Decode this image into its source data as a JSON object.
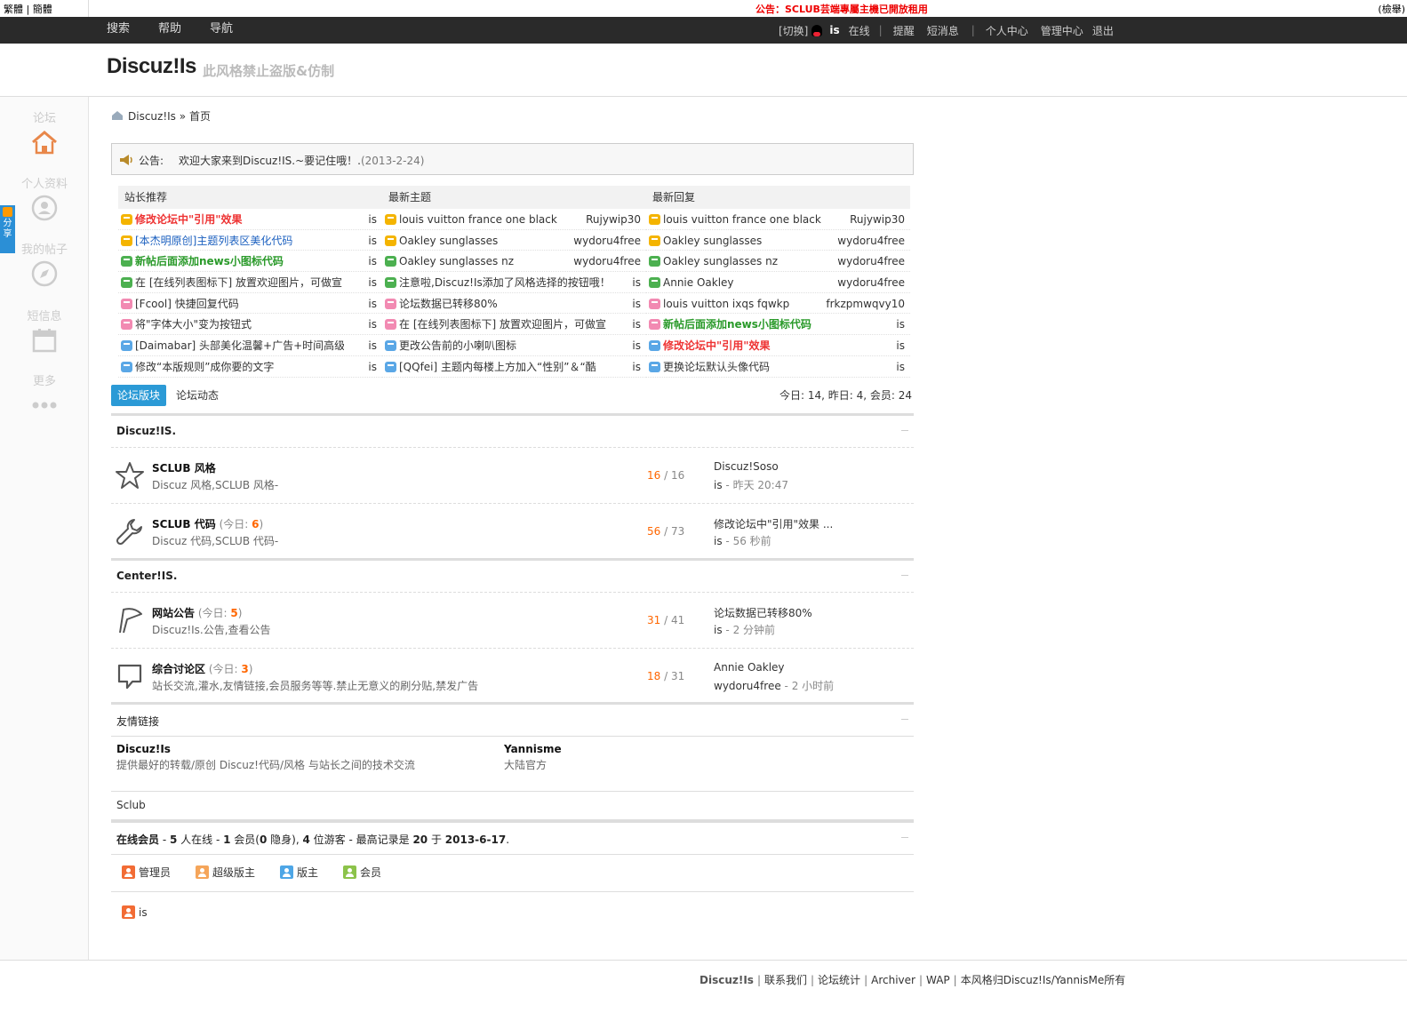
{
  "topbar": {
    "lang": "繁體 | 簡體",
    "announcement": "公告：SCLUB芸端專屬主機已開放租用",
    "right": "(檢舉)"
  },
  "nav": {
    "left": [
      "搜索",
      "帮助",
      "导航"
    ],
    "switch": "[切换]",
    "user": "is",
    "online": "在线",
    "sep": "|",
    "right": [
      "提醒",
      "短消息"
    ],
    "right2": [
      "个人中心",
      "管理中心",
      "退出"
    ]
  },
  "header": {
    "logo": "Discuz!Is",
    "slogan": "此风格禁止盗版&仿制"
  },
  "sidebar": {
    "items": [
      {
        "label": "论坛",
        "icon": "home-icon"
      },
      {
        "label": "个人资料",
        "icon": "user-icon"
      },
      {
        "label": "我的帖子",
        "icon": "compass-icon"
      },
      {
        "label": "短信息",
        "icon": "calendar-icon"
      },
      {
        "label": "更多",
        "icon": "more-icon"
      }
    ],
    "share": "分享"
  },
  "breadcrumb": {
    "site": "Discuz!Is",
    "sep": "»",
    "current": "首页"
  },
  "announcement": {
    "label": "公告:",
    "text": "欢迎大家来到Discuz!IS.~要记住哦！.",
    "date": "(2013-2-24)"
  },
  "recommend": {
    "columns": [
      {
        "title": "站长推荐",
        "rows": [
          {
            "title": "修改论坛中\"引用\"效果",
            "author": "is",
            "color": "#e33",
            "bold": true,
            "icon": "#f4b400"
          },
          {
            "title": "[本杰明原创]主题列表区美化代码",
            "author": "is",
            "color": "#1a5fbf",
            "bold": false,
            "icon": "#f4b400"
          },
          {
            "title": "新帖后面添加news小图标代码",
            "author": "is",
            "color": "#2a9a2a",
            "bold": true,
            "icon": "#4cb050"
          },
          {
            "title": "在 [在线列表图标下] 放置欢迎图片，可做宣",
            "author": "is",
            "color": "#333",
            "bold": false,
            "icon": "#4cb050"
          },
          {
            "title": "[Fcool] 快捷回复代码",
            "author": "is",
            "color": "#333",
            "bold": false,
            "icon": "#f28ab2"
          },
          {
            "title": "将\"字体大小\"变为按钮式",
            "author": "is",
            "color": "#333",
            "bold": false,
            "icon": "#f28ab2"
          },
          {
            "title": "[Daimabar] 头部美化温馨+广告+时间高级",
            "author": "is",
            "color": "#333",
            "bold": false,
            "icon": "#5aa7e6"
          },
          {
            "title": "修改“本版规则”成你要的文字",
            "author": "is",
            "color": "#333",
            "bold": false,
            "icon": "#5aa7e6"
          }
        ]
      },
      {
        "title": "最新主题",
        "rows": [
          {
            "title": "louis vuitton france one black",
            "author": "Rujywip30",
            "color": "#333",
            "bold": false,
            "icon": "#f4b400"
          },
          {
            "title": "Oakley sunglasses",
            "author": "wydoru4free",
            "color": "#333",
            "bold": false,
            "icon": "#f4b400"
          },
          {
            "title": "Oakley sunglasses nz",
            "author": "wydoru4free",
            "color": "#333",
            "bold": false,
            "icon": "#4cb050"
          },
          {
            "title": "注意啦,Discuz!Is添加了风格选择的按钮哦！",
            "author": "is",
            "color": "#333",
            "bold": false,
            "icon": "#4cb050"
          },
          {
            "title": "论坛数据已转移80%",
            "author": "is",
            "color": "#333",
            "bold": false,
            "icon": "#f28ab2"
          },
          {
            "title": "在 [在线列表图标下] 放置欢迎图片，可做宣",
            "author": "is",
            "color": "#333",
            "bold": false,
            "icon": "#f28ab2"
          },
          {
            "title": "更改公告前的小喇叭图标",
            "author": "is",
            "color": "#333",
            "bold": false,
            "icon": "#5aa7e6"
          },
          {
            "title": "[QQfei] 主题内每楼上方加入“性别”＆“酷",
            "author": "is",
            "color": "#333",
            "bold": false,
            "icon": "#5aa7e6"
          }
        ]
      },
      {
        "title": "最新回复",
        "rows": [
          {
            "title": "louis vuitton france one black",
            "author": "Rujywip30",
            "color": "#333",
            "bold": false,
            "icon": "#f4b400"
          },
          {
            "title": "Oakley sunglasses",
            "author": "wydoru4free",
            "color": "#333",
            "bold": false,
            "icon": "#f4b400"
          },
          {
            "title": "Oakley sunglasses nz",
            "author": "wydoru4free",
            "color": "#333",
            "bold": false,
            "icon": "#4cb050"
          },
          {
            "title": "Annie Oakley",
            "author": "wydoru4free",
            "color": "#333",
            "bold": false,
            "icon": "#4cb050"
          },
          {
            "title": "louis vuitton ixqs fqwkp",
            "author": "frkzpmwqvy10",
            "color": "#333",
            "bold": false,
            "icon": "#f28ab2"
          },
          {
            "title": "新帖后面添加news小图标代码",
            "author": "is",
            "color": "#2a9a2a",
            "bold": true,
            "icon": "#f28ab2"
          },
          {
            "title": "修改论坛中\"引用\"效果",
            "author": "is",
            "color": "#e33",
            "bold": true,
            "icon": "#5aa7e6"
          },
          {
            "title": "更换论坛默认头像代码",
            "author": "is",
            "color": "#333",
            "bold": false,
            "icon": "#5aa7e6"
          }
        ]
      }
    ]
  },
  "tabs": {
    "items": [
      "论坛版块",
      "论坛动态"
    ],
    "stats": "今日: 14, 昨日: 4, 会员: 24"
  },
  "categories": [
    {
      "name": "Discuz!IS.",
      "forums": [
        {
          "name": "SCLUB 风格",
          "today_label": "",
          "today": "",
          "desc": "Discuz 风格,SCLUB 风格-",
          "threads": "16",
          "posts": "16",
          "last_title": "Discuz!Soso",
          "last_user": "is",
          "last_time": "昨天 20:47",
          "icon": "star-icon"
        },
        {
          "name": "SCLUB 代码",
          "today_label": "(今日: ",
          "today": "6",
          "desc": "Discuz 代码,SCLUB 代码-",
          "threads": "56",
          "posts": "73",
          "last_title": "修改论坛中\"引用\"效果 ...",
          "last_user": "is",
          "last_time": "56 秒前",
          "icon": "wrench-icon"
        }
      ]
    },
    {
      "name": "Center!IS.",
      "forums": [
        {
          "name": "网站公告",
          "today_label": "(今日: ",
          "today": "5",
          "desc": "Discuz!Is.公告,查看公告",
          "threads": "31",
          "posts": "41",
          "last_title": "论坛数据已转移80%",
          "last_user": "is",
          "last_time": "2 分钟前",
          "icon": "flag-icon"
        },
        {
          "name": "综合讨论区",
          "today_label": "(今日: ",
          "today": "3",
          "desc": "站长交流,灌水,友情链接,会员服务等等.禁止无意义的刷分贴,禁发广告",
          "threads": "18",
          "posts": "31",
          "last_title": "Annie Oakley",
          "last_user": "wydoru4free",
          "last_time": "2 小时前",
          "icon": "chat-icon"
        }
      ]
    }
  ],
  "friendlinks": {
    "title": "友情链接",
    "items": [
      {
        "name": "Discuz!Is",
        "desc": "提供最好的转载/原创 Discuz!代码/风格 与站长之间的技术交流"
      },
      {
        "name": "Yannisme",
        "desc": "大陆官方"
      }
    ],
    "text": "Sclub"
  },
  "online": {
    "label": "在线会员",
    "sep": " - ",
    "total": "5",
    "s1": " 人在线 - ",
    "members": "1",
    "s2": " 会员(",
    "hidden": "0",
    "s3": " 隐身), ",
    "guests": "4",
    "s4": " 位游客 - 最高记录是 ",
    "record": "20",
    "s5": " 于 ",
    "date": "2013-6-17",
    "s6": ".",
    "groups": [
      {
        "name": "管理员",
        "color": "#f26c35"
      },
      {
        "name": "超级版主",
        "color": "#f5a55a"
      },
      {
        "name": "版主",
        "color": "#4ea6e6"
      },
      {
        "name": "会员",
        "color": "#8cc34a"
      }
    ],
    "users": [
      {
        "name": "is",
        "color": "#f26c35"
      }
    ]
  },
  "footer": {
    "brand": "Discuz!Is",
    "links": [
      "联系我们",
      "论坛统计",
      "Archiver",
      "WAP",
      "本风格归Discuz!Is/YannisMe所有"
    ],
    "sep": "|"
  }
}
